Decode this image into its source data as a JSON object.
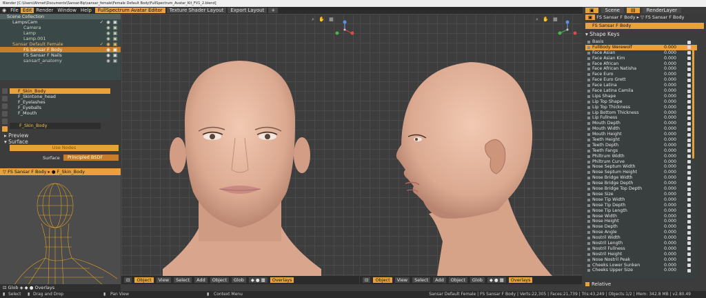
{
  "window_title": "Blender [C:\\Users\\Ahmet\\Documents\\Sansar-Bip\\sansar_female\\Female Default Body\\FullSpectrum_Avatar_Kit_FV1_2.blend]",
  "menu": [
    "File",
    "Edit",
    "Render",
    "Window",
    "Help"
  ],
  "workspaces": [
    "FullSpectrum Avatar Editor",
    "Texture Shader Layout",
    "Export Layout",
    "+"
  ],
  "top_right": {
    "scene": "Scene",
    "render_layer": "RenderLayer"
  },
  "outliner": [
    {
      "label": "Scene Collection"
    },
    {
      "label": "LampsCam"
    },
    {
      "label": "Camera"
    },
    {
      "label": "Lamp"
    },
    {
      "label": "Lamp.001"
    },
    {
      "label": "Sansar Default Female"
    },
    {
      "label": "FS Sansar F Body"
    },
    {
      "label": "FS Sansar F Nails"
    },
    {
      "label": "sansarf_anatomy"
    }
  ],
  "materials": [
    "F_Skin_Body",
    "F_Skintone_head",
    "F_Eyelashes",
    "F_Eyeballs",
    "F_Mouth"
  ],
  "material_field": "F_Skin_Body",
  "panels": {
    "preview": "Preview",
    "surface": "Surface",
    "use_nodes": "Use Nodes",
    "surface_label": "Surface",
    "surface_value": "Principled BSDF"
  },
  "breadcrumb": {
    "object": "FS Sansar F Body",
    "material": "F_Skin_Body"
  },
  "left_header": [
    "Glob",
    "Overlays"
  ],
  "viewport_header": {
    "mode": "Object",
    "view": "View",
    "select": "Select",
    "add": "Add",
    "object": "Object",
    "glob": "Glob",
    "overlays": "Overlays"
  },
  "viewport2_header": {
    "mode": "Object",
    "view": "View",
    "select": "Select",
    "add": "Add",
    "object": "Object",
    "glob": "Glob",
    "overlays": "Overlays"
  },
  "properties": {
    "object_name": "FS Sansar F Body",
    "breadcrumb": "FS Sansar F Body",
    "breadcrumb2": "FS Sansar F Body"
  },
  "shape_keys_title": "Shape Keys",
  "shape_keys": [
    {
      "name": "Basis",
      "value": ""
    },
    {
      "name": "FullBody Werewolf",
      "value": "0.000"
    },
    {
      "name": "Face Asian",
      "value": "0.000"
    },
    {
      "name": "Face Asian Kim",
      "value": "0.000"
    },
    {
      "name": "Face African",
      "value": "0.000"
    },
    {
      "name": "Face African Natisha",
      "value": "0.000"
    },
    {
      "name": "Face Euro",
      "value": "0.000"
    },
    {
      "name": "Face Euro Grett",
      "value": "0.000"
    },
    {
      "name": "Face Latina",
      "value": "0.000"
    },
    {
      "name": "Face Latina Camila",
      "value": "0.000"
    },
    {
      "name": "Lips Shape",
      "value": "0.000"
    },
    {
      "name": "Lip Top Shape",
      "value": "0.000"
    },
    {
      "name": "Lip Top Thickness",
      "value": "0.000"
    },
    {
      "name": "Lip Bottom Thickness",
      "value": "0.000"
    },
    {
      "name": "Lip Fullness",
      "value": "0.000"
    },
    {
      "name": "Mouth Depth",
      "value": "0.000"
    },
    {
      "name": "Mouth Width",
      "value": "0.000"
    },
    {
      "name": "Mouth Height",
      "value": "0.000"
    },
    {
      "name": "Teeth Height",
      "value": "0.000"
    },
    {
      "name": "Teeth Depth",
      "value": "0.000"
    },
    {
      "name": "Teeth Fangs",
      "value": "0.000"
    },
    {
      "name": "Philtrum Width",
      "value": "0.000"
    },
    {
      "name": "Philtrum Curve",
      "value": "0.000"
    },
    {
      "name": "Nose Septum Width",
      "value": "0.000"
    },
    {
      "name": "Nose Septum Height",
      "value": "0.000"
    },
    {
      "name": "Nose Bridge Width",
      "value": "0.000"
    },
    {
      "name": "Nose Bridge Depth",
      "value": "0.000"
    },
    {
      "name": "Nose Bridge Top Depth",
      "value": "0.000"
    },
    {
      "name": "Nose Size",
      "value": "0.000"
    },
    {
      "name": "Nose Tip Width",
      "value": "0.000"
    },
    {
      "name": "Nose Tip Depth",
      "value": "0.000"
    },
    {
      "name": "Nose Tip Length",
      "value": "0.000"
    },
    {
      "name": "Nose Width",
      "value": "0.000"
    },
    {
      "name": "Nose Height",
      "value": "0.000"
    },
    {
      "name": "Nose Depth",
      "value": "0.000"
    },
    {
      "name": "Nose Angle",
      "value": "0.000"
    },
    {
      "name": "Nostril Width",
      "value": "0.000"
    },
    {
      "name": "Nostril Length",
      "value": "0.000"
    },
    {
      "name": "Nostril Fullness",
      "value": "0.000"
    },
    {
      "name": "Nostril Height",
      "value": "0.000"
    },
    {
      "name": "Nose Nostril Peak",
      "value": "0.000"
    },
    {
      "name": "Cheeks Lower Sunken",
      "value": "0.000"
    },
    {
      "name": "Cheeks Upper Size",
      "value": "0.000"
    }
  ],
  "relative_label": "Relative",
  "status": {
    "select": "Select",
    "drag": "Drag and Drop",
    "pan": "Pan View",
    "context": "Context Menu",
    "info": "Sansar Default Female | FS Sansar F Body | Verts:22,305 | Faces:21,739 | Tris:43,249 | Objects:1/2 | Mem: 342.8 MB | v2.80.49"
  },
  "colors": {
    "accent": "#e9a13b",
    "skin": "#e8b9a0",
    "panel": "#3c3c3c"
  }
}
